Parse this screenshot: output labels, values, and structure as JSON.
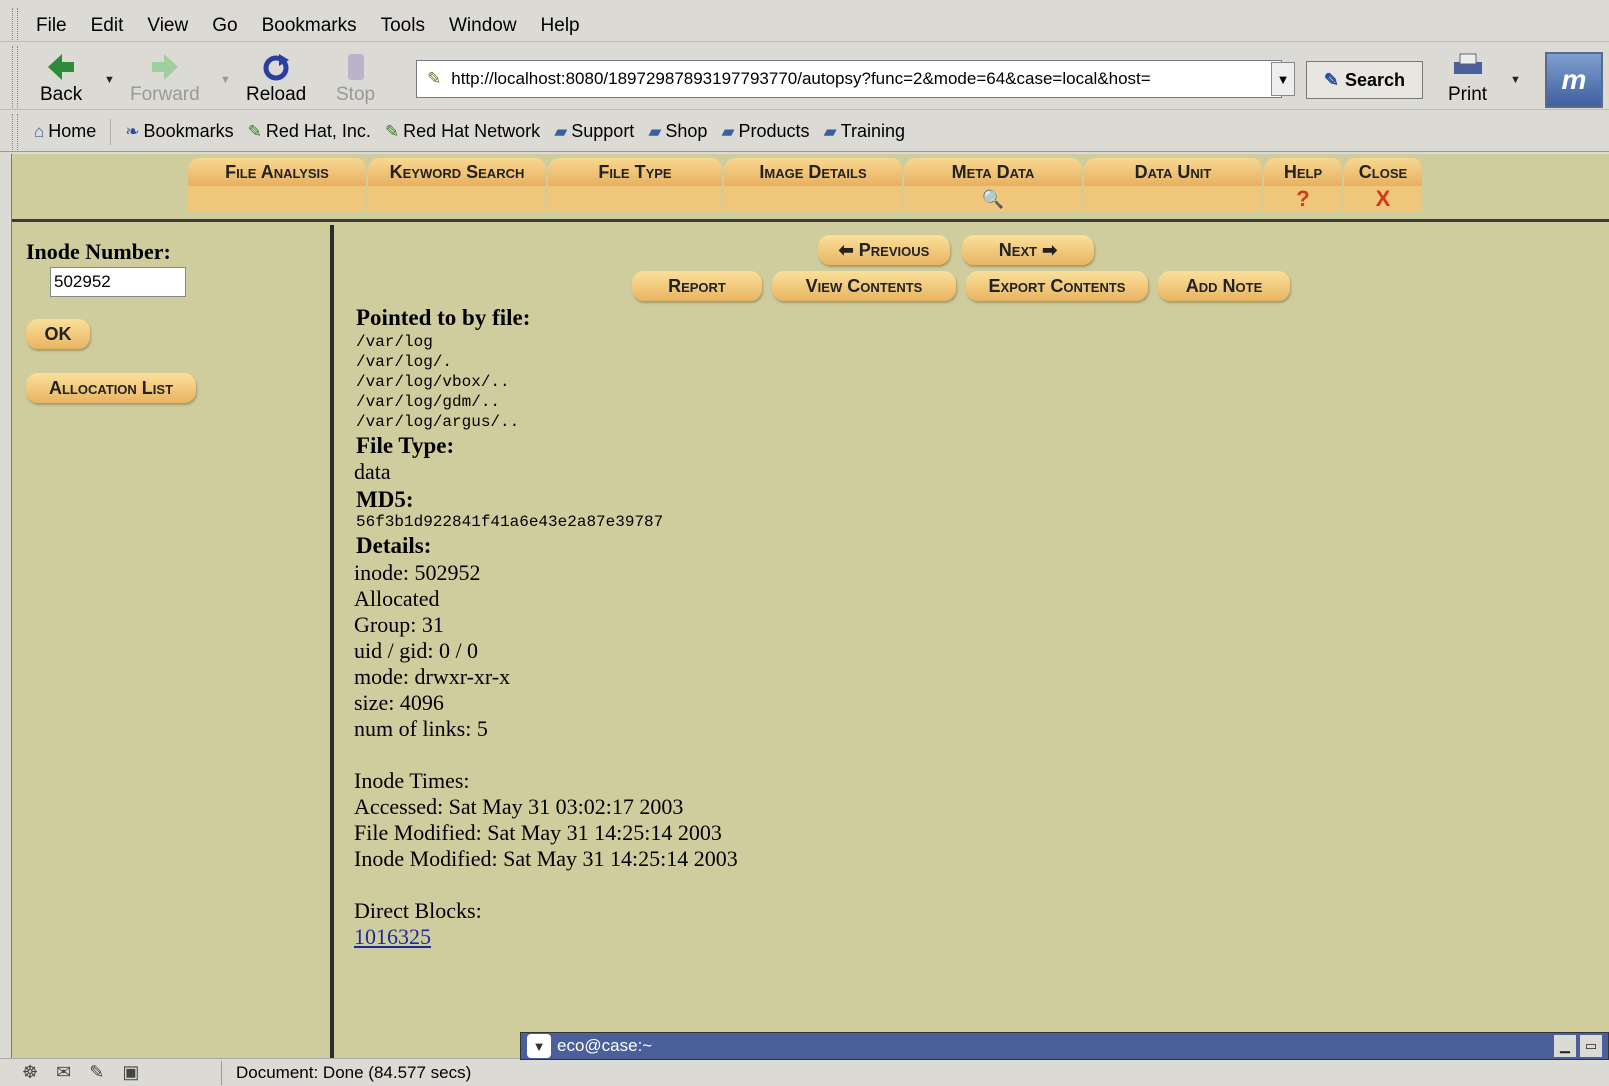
{
  "menubar": {
    "items": [
      "File",
      "Edit",
      "View",
      "Go",
      "Bookmarks",
      "Tools",
      "Window",
      "Help"
    ]
  },
  "nav": {
    "back": "Back",
    "forward": "Forward",
    "reload": "Reload",
    "stop": "Stop",
    "url": "http://localhost:8080/18972987893197793770/autopsy?func=2&mode=64&case=local&host=",
    "search": "Search",
    "print": "Print"
  },
  "personal": {
    "items": [
      "Home",
      "Bookmarks",
      "Red Hat, Inc.",
      "Red Hat Network",
      "Support",
      "Shop",
      "Products",
      "Training"
    ]
  },
  "tabs": [
    {
      "label": "File Analysis",
      "sub": ""
    },
    {
      "label": "Keyword Search",
      "sub": ""
    },
    {
      "label": "File Type",
      "sub": ""
    },
    {
      "label": "Image Details",
      "sub": ""
    },
    {
      "label": "Meta Data",
      "sub": "🔍"
    },
    {
      "label": "Data Unit",
      "sub": ""
    },
    {
      "label": "Help",
      "sub": "?"
    },
    {
      "label": "Close",
      "sub": "X"
    }
  ],
  "left": {
    "title": "Inode Number:",
    "inode_value": "502952",
    "ok": "OK",
    "alloc": "Allocation List"
  },
  "right": {
    "prev": "Previous",
    "next": "Next",
    "report": "Report",
    "view": "View Contents",
    "export": "Export Contents",
    "note": "Add Note",
    "pointed_title": "Pointed to by file:",
    "paths": [
      "/var/log",
      "/var/log/.",
      "/var/log/vbox/..",
      "/var/log/gdm/..",
      "/var/log/argus/.."
    ],
    "filetype_title": "File Type:",
    "filetype": "data",
    "md5_title": "MD5:",
    "md5": "56f3b1d922841f41a6e43e2a87e39787",
    "details_title": "Details:",
    "details": [
      "inode: 502952",
      "Allocated",
      "Group: 31",
      "uid / gid: 0 / 0",
      "mode: drwxr-xr-x",
      "size: 4096",
      "num of links: 5"
    ],
    "times_title": "Inode Times:",
    "times": [
      "Accessed: Sat May 31 03:02:17 2003",
      "File Modified: Sat May 31 14:25:14 2003",
      "Inode Modified: Sat May 31 14:25:14 2003"
    ],
    "blocks_title": "Direct Blocks:",
    "block": "1016325"
  },
  "status": {
    "text": "Document: Done (84.577 secs)",
    "task": "eco@case:~"
  }
}
